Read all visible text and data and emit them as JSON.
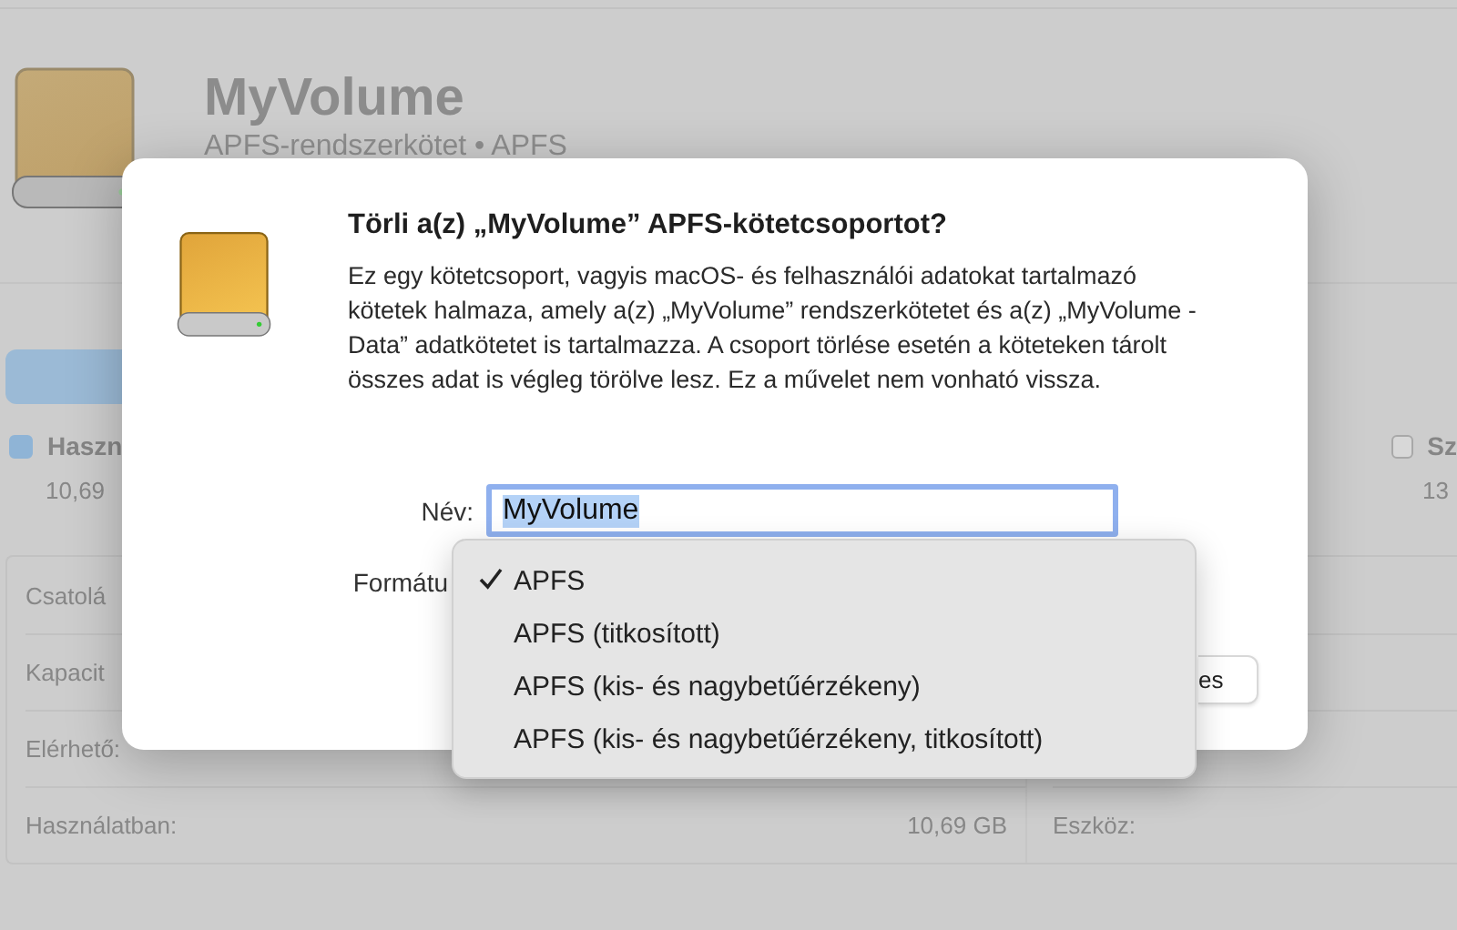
{
  "window": {
    "volume_name": "MyVolume",
    "volume_subtitle": "APFS-rendszerkötet • APFS"
  },
  "usage_legend": [
    {
      "label": "Haszn",
      "value": "10,69",
      "checked": true,
      "color": "#8fb4d6"
    },
    {
      "label": "Sz",
      "value": "13",
      "checked": false,
      "color": "#d8d8d8"
    }
  ],
  "info_rows": [
    {
      "label": "Csatolá",
      "value": "",
      "right_label": ""
    },
    {
      "label": "Kapacit",
      "value": "",
      "right_label": ""
    },
    {
      "label": "Elérhető:",
      "value": "",
      "right_label": ""
    },
    {
      "label": "Használatban:",
      "value": "10,69 GB",
      "right_label": "Eszköz:"
    }
  ],
  "dialog": {
    "title": "Törli a(z) „MyVolume” APFS-kötetcsoportot?",
    "message": "Ez egy kötetcsoport, vagyis macOS- és felhasználói adatokat tartalmazó kötetek halmaza, amely a(z) „MyVolume” rendszerkötetet és a(z) „MyVolume - Data” adatkötetet is tartalmazza. A csoport törlése esetén a köteteken tárolt összes adat is végleg törölve lesz. Ez a művelet nem vonható vissza.",
    "name_label": "Név:",
    "name_value": "MyVolume",
    "name_text_selected": true,
    "format_label": "Formátu",
    "button": "es"
  },
  "format_menu": {
    "items": [
      {
        "label": "APFS",
        "selected": true
      },
      {
        "label": "APFS (titkosított)",
        "selected": false
      },
      {
        "label": "APFS (kis- és nagybetűérzékeny)",
        "selected": false
      },
      {
        "label": "APFS (kis- és nagybetűérzékeny, titkosított)",
        "selected": false
      }
    ]
  }
}
